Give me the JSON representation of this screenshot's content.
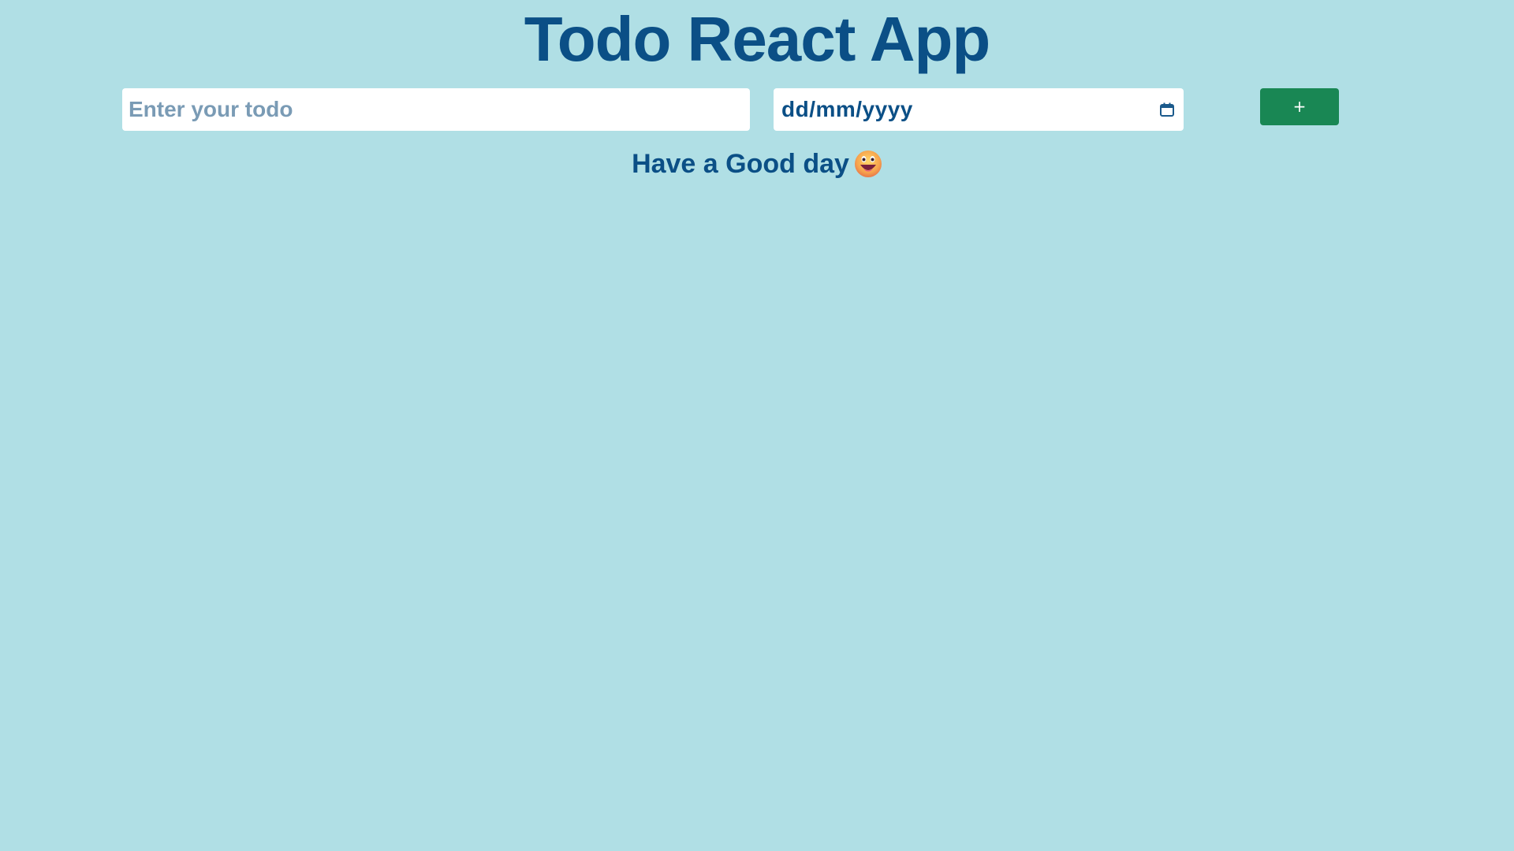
{
  "app": {
    "title": "Todo React App"
  },
  "form": {
    "todo_placeholder": "Enter your todo",
    "todo_value": "",
    "date_placeholder": "dd/mm/yyyy",
    "add_label": "+"
  },
  "message": {
    "text": "Have a Good day",
    "emoji_icon": "grinning-face-icon"
  },
  "colors": {
    "background": "#b0dfe5",
    "primary_text": "#0b4f86",
    "button": "#198754",
    "input_bg": "#ffffff"
  }
}
